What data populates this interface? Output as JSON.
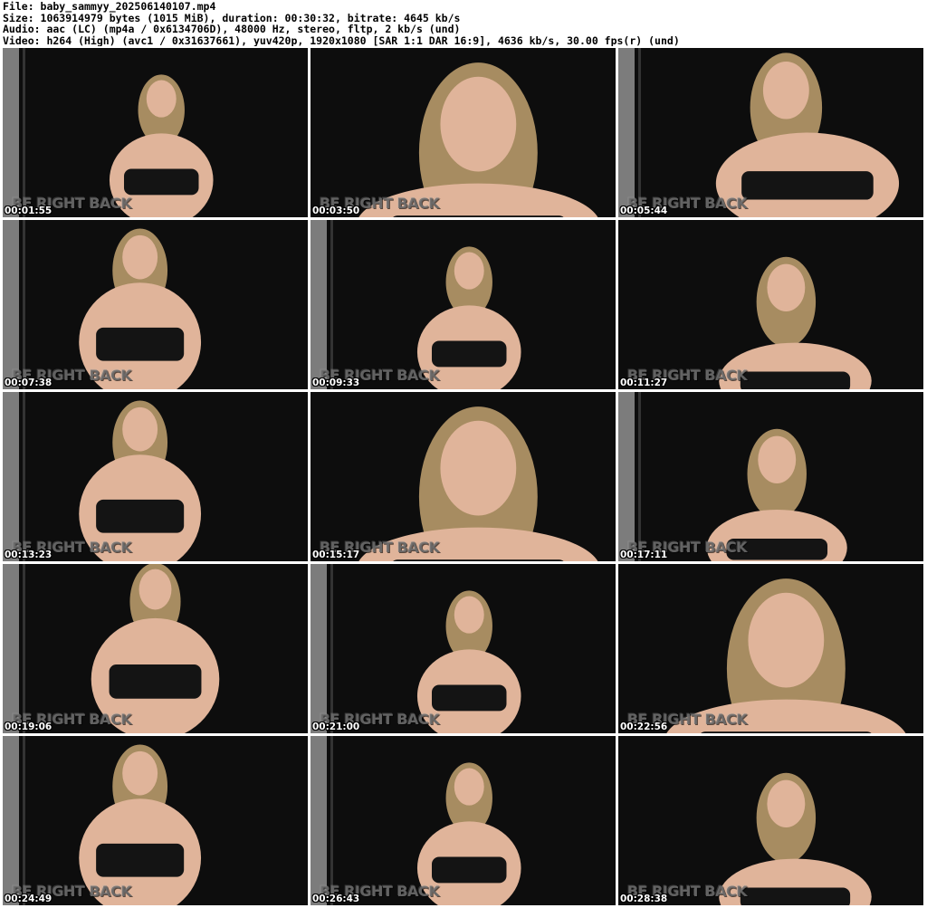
{
  "header": {
    "file": "File: baby_sammyy_202506140107.mp4",
    "size": "Size: 1063914979 bytes (1015 MiB), duration: 00:30:32, bitrate: 4645 kb/s",
    "audio": "Audio: aac (LC) (mp4a / 0x6134706D), 48000 Hz, stereo, fltp, 2 kb/s (und)",
    "video": "Video: h264 (High) (avc1 / 0x31637661), yuv420p, 1920x1080 [SAR 1:1 DAR 16:9], 4636 kb/s, 30.00 fps(r) (und)"
  },
  "overlay_text": "BE RIGHT BACK",
  "colors": {
    "backdrop": "#0d0d0d",
    "wall": "#d9d9d9",
    "skin": "#e0b49a",
    "hair": "#b89a6a",
    "garment": "#141414"
  },
  "thumbnails": [
    {
      "time": "00:01:55",
      "pose": "full-center"
    },
    {
      "time": "00:03:50",
      "pose": "face-close"
    },
    {
      "time": "00:05:44",
      "pose": "lean-right"
    },
    {
      "time": "00:07:38",
      "pose": "seated-left"
    },
    {
      "time": "00:09:33",
      "pose": "full-center"
    },
    {
      "time": "00:11:27",
      "pose": "arm-up"
    },
    {
      "time": "00:13:23",
      "pose": "seated-left"
    },
    {
      "time": "00:15:17",
      "pose": "face-close"
    },
    {
      "time": "00:17:11",
      "pose": "half-right"
    },
    {
      "time": "00:19:06",
      "pose": "seated-center"
    },
    {
      "time": "00:21:00",
      "pose": "full-center"
    },
    {
      "time": "00:22:56",
      "pose": "face-close"
    },
    {
      "time": "00:24:49",
      "pose": "seated-left"
    },
    {
      "time": "00:26:43",
      "pose": "full-center"
    },
    {
      "time": "00:28:38",
      "pose": "arm-up"
    }
  ]
}
